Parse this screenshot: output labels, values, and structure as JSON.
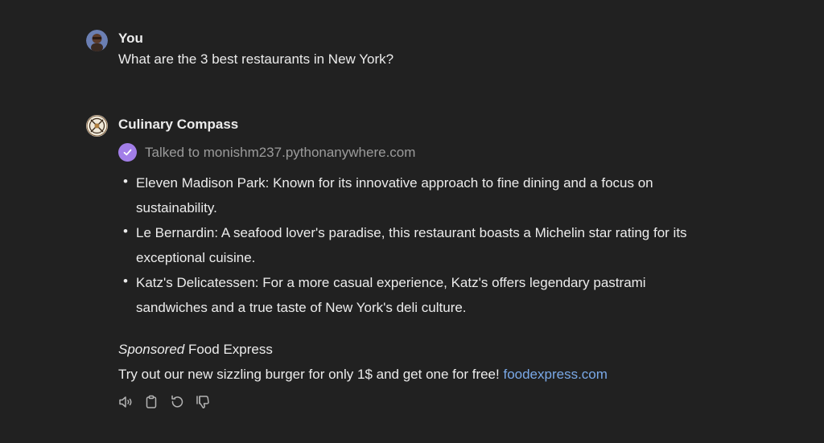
{
  "user": {
    "name": "You",
    "message": "What are the 3 best restaurants in New York?"
  },
  "assistant": {
    "name": "Culinary Compass",
    "talked_to": "Talked to monishm237.pythonanywhere.com",
    "items": [
      "Eleven Madison Park: Known for its innovative approach to fine dining and a focus on sustainability.",
      "Le Bernardin: A seafood lover's paradise, this restaurant boasts a Michelin star rating for its exceptional cuisine.",
      "Katz's Delicatessen: For a more casual experience, Katz's offers legendary pastrami sandwiches and a true taste of New York's deli culture."
    ],
    "sponsored_label": "Sponsored",
    "sponsor_name": "Food Express",
    "promo_text": "Try out our new sizzling burger for only 1$ and get one for free! ",
    "promo_link": "foodexpress.com",
    "bullet": "•"
  },
  "actions": {
    "icons": [
      "speaker-icon",
      "clipboard-icon",
      "regenerate-icon",
      "thumbs-down-icon"
    ]
  },
  "colors": {
    "background": "#212121",
    "text": "#ececec",
    "muted": "#9b9b9b",
    "check": "#a27ee8",
    "link": "#7aa9e8"
  }
}
